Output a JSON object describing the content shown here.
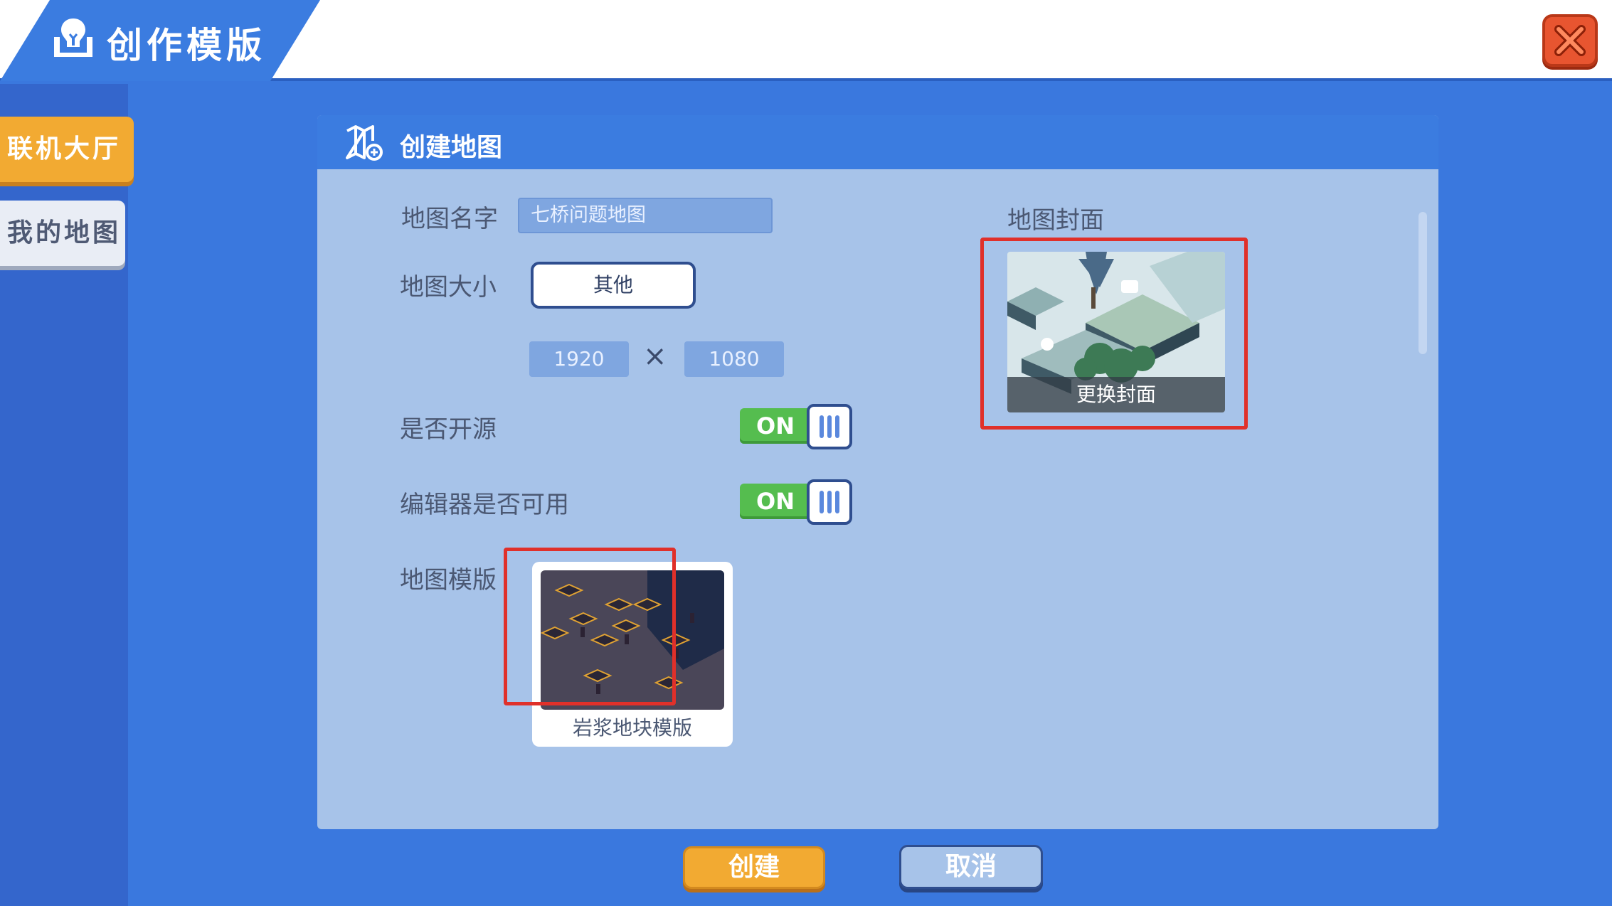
{
  "header": {
    "title": "创作模版",
    "title_icon": "lightbulb-book-icon",
    "close_icon": "close-icon"
  },
  "sidebar": {
    "items": [
      {
        "label": "联机大厅",
        "active": true
      },
      {
        "label": "我的地图",
        "active": false
      }
    ]
  },
  "dialog": {
    "title": "创建地图",
    "title_icon": "map-add-icon",
    "name_label": "地图名字",
    "name_value": "七桥问题地图",
    "size_label": "地图大小",
    "size_option": "其他",
    "width_value": "1920",
    "height_value": "1080",
    "times_symbol": "×",
    "open_source_label": "是否开源",
    "open_source_toggle": "ON",
    "editor_label": "编辑器是否可用",
    "editor_toggle": "ON",
    "template_label": "地图模版",
    "template_name": "岩浆地块模版",
    "cover_label": "地图封面",
    "cover_change_label": "更换封面"
  },
  "actions": {
    "create_label": "创建",
    "cancel_label": "取消"
  },
  "colors": {
    "background": "#3a78de",
    "accent_orange": "#f2aa32",
    "panel": "#a7c3e9",
    "toggle_on": "#55bd4f",
    "close_red": "#e85530",
    "highlight_red": "#e0302a"
  }
}
